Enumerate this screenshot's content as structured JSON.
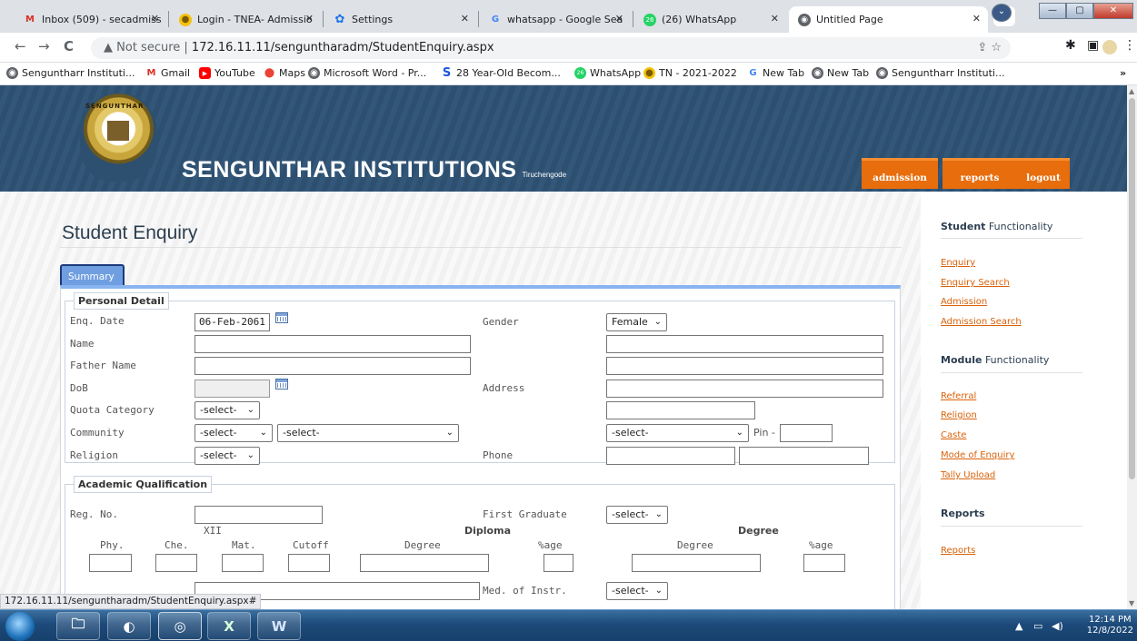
{
  "browser": {
    "tabs": [
      {
        "title": "Inbox (509) - secadmiss",
        "icon": "gmail-icon"
      },
      {
        "title": "Login - TNEA- Admissio",
        "icon": "tnea-icon"
      },
      {
        "title": "Settings",
        "icon": "gear-icon"
      },
      {
        "title": "whatsapp - Google Sea",
        "icon": "google-icon"
      },
      {
        "title": "(26) WhatsApp",
        "icon": "whatsapp-icon"
      },
      {
        "title": "Untitled Page",
        "icon": "globe-icon"
      }
    ],
    "url_prefix": "Not secure",
    "url": "172.16.11.11/senguntharadm/StudentEnquiry.aspx",
    "bookmarks": [
      "Senguntharr Instituti...",
      "Gmail",
      "YouTube",
      "Maps",
      "Microsoft Word - Pr...",
      "28 Year-Old Becom...",
      "WhatsApp",
      "TN - 2021-2022",
      "New Tab",
      "New Tab",
      "Senguntharr Instituti..."
    ],
    "bookmarks_more": "»",
    "status_url": "172.16.11.11/senguntharadm/StudentEnquiry.aspx#"
  },
  "header": {
    "brand": "SENGUNTHAR INSTITUTIONS",
    "sub": "Tiruchengode",
    "logo_text": "SENGUNTHAR",
    "nav": [
      "admission",
      "reports",
      "logout"
    ]
  },
  "page": {
    "title": "Student Enquiry",
    "tab_label": "Summary"
  },
  "personal": {
    "legend": "Personal Detail",
    "enq_date_label": "Enq. Date",
    "enq_date_value": "06-Feb-2061",
    "name_label": "Name",
    "father_label": "Father Name",
    "dob_label": "DoB",
    "quota_label": "Quota Category",
    "quota_value": "-select-",
    "community_label": "Community",
    "community_value": "-select-",
    "caste_value": "-select-",
    "religion_label": "Religion",
    "religion_value": "-select-",
    "gender_label": "Gender",
    "gender_value": "Female",
    "address_label": "Address",
    "district_value": "-select-",
    "pin_label": "Pin -",
    "phone_label": "Phone"
  },
  "academic": {
    "legend": "Academic Qualification",
    "reg_label": "Reg. No.",
    "first_grad_label": "First Graduate",
    "first_grad_value": "-select-",
    "xii_label": "XII",
    "diploma_label": "Diploma",
    "degree_label": "Degree",
    "cols": [
      "Phy.",
      "Che.",
      "Mat.",
      "Cutoff",
      "Degree",
      "%age",
      "Degree",
      "%age"
    ],
    "medium_label": "Med. of Instr.",
    "medium_value": "-select-"
  },
  "sidebar": {
    "student_heading_bold": "Student",
    "student_heading_rest": " Functionality",
    "student_links": [
      "Enquiry",
      "Enquiry Search",
      "Admission",
      "Admission Search"
    ],
    "module_heading_bold": "Module",
    "module_heading_rest": " Functionality",
    "module_links": [
      "Referral",
      "Religion",
      "Caste",
      "Mode of Enquiry",
      "Tally Upload"
    ],
    "reports_heading": "Reports",
    "reports_links": [
      "Reports"
    ]
  },
  "taskbar": {
    "time": "12:14 PM",
    "date": "12/8/2022"
  }
}
